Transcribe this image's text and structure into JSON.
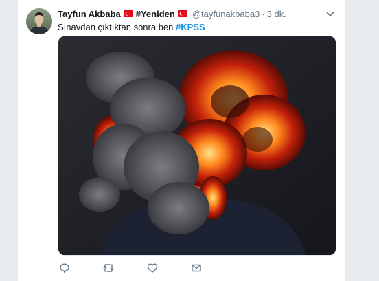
{
  "tweet": {
    "author_name": "Tayfun Akbaba",
    "author_tagline": "#Yeniden",
    "handle": "@tayfunakbaba3",
    "separator": "·",
    "time": "3 dk.",
    "text": "Sınavdan çıktıktan sonra ben",
    "hashtag": "#KPSS"
  },
  "icons": {
    "flag": "turkey-flag-icon",
    "caret": "chevron-down-icon",
    "reply": "reply-icon",
    "retweet": "retweet-icon",
    "like": "heart-icon",
    "dm": "envelope-icon"
  },
  "colors": {
    "hashtag": "#1b95e0",
    "text": "#14171a",
    "muted": "#657786",
    "flag_red": "#e30a17"
  }
}
